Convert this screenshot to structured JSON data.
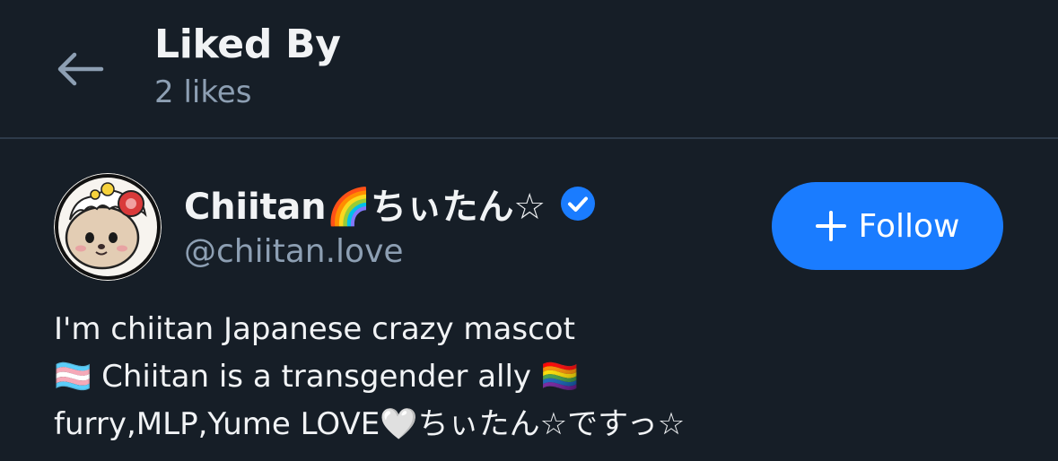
{
  "header": {
    "title": "Liked By",
    "subtitle": "2 likes",
    "back_icon": "arrow-left-icon"
  },
  "colors": {
    "background": "#161e27",
    "divider": "#2e3b4a",
    "secondary_text": "#8d9fb3",
    "primary_text": "#f1f3f5",
    "accent": "#1a7cff",
    "verified": "#1a7cff"
  },
  "user": {
    "display_name": "Chiitan🌈ちぃたん☆",
    "handle": "@chiitan.love",
    "verified": true,
    "verified_icon": "verified-check-icon",
    "avatar_icon": "otter-mascot-avatar",
    "follow_label": "Follow",
    "follow_icon": "plus-icon",
    "bio": [
      "I'm chiitan Japanese crazy mascot",
      "🏳️‍⚧️ Chiitan is a transgender ally 🏳️‍🌈",
      "furry,MLP,Yume LOVE🤍ちぃたん☆ですっ☆"
    ]
  }
}
